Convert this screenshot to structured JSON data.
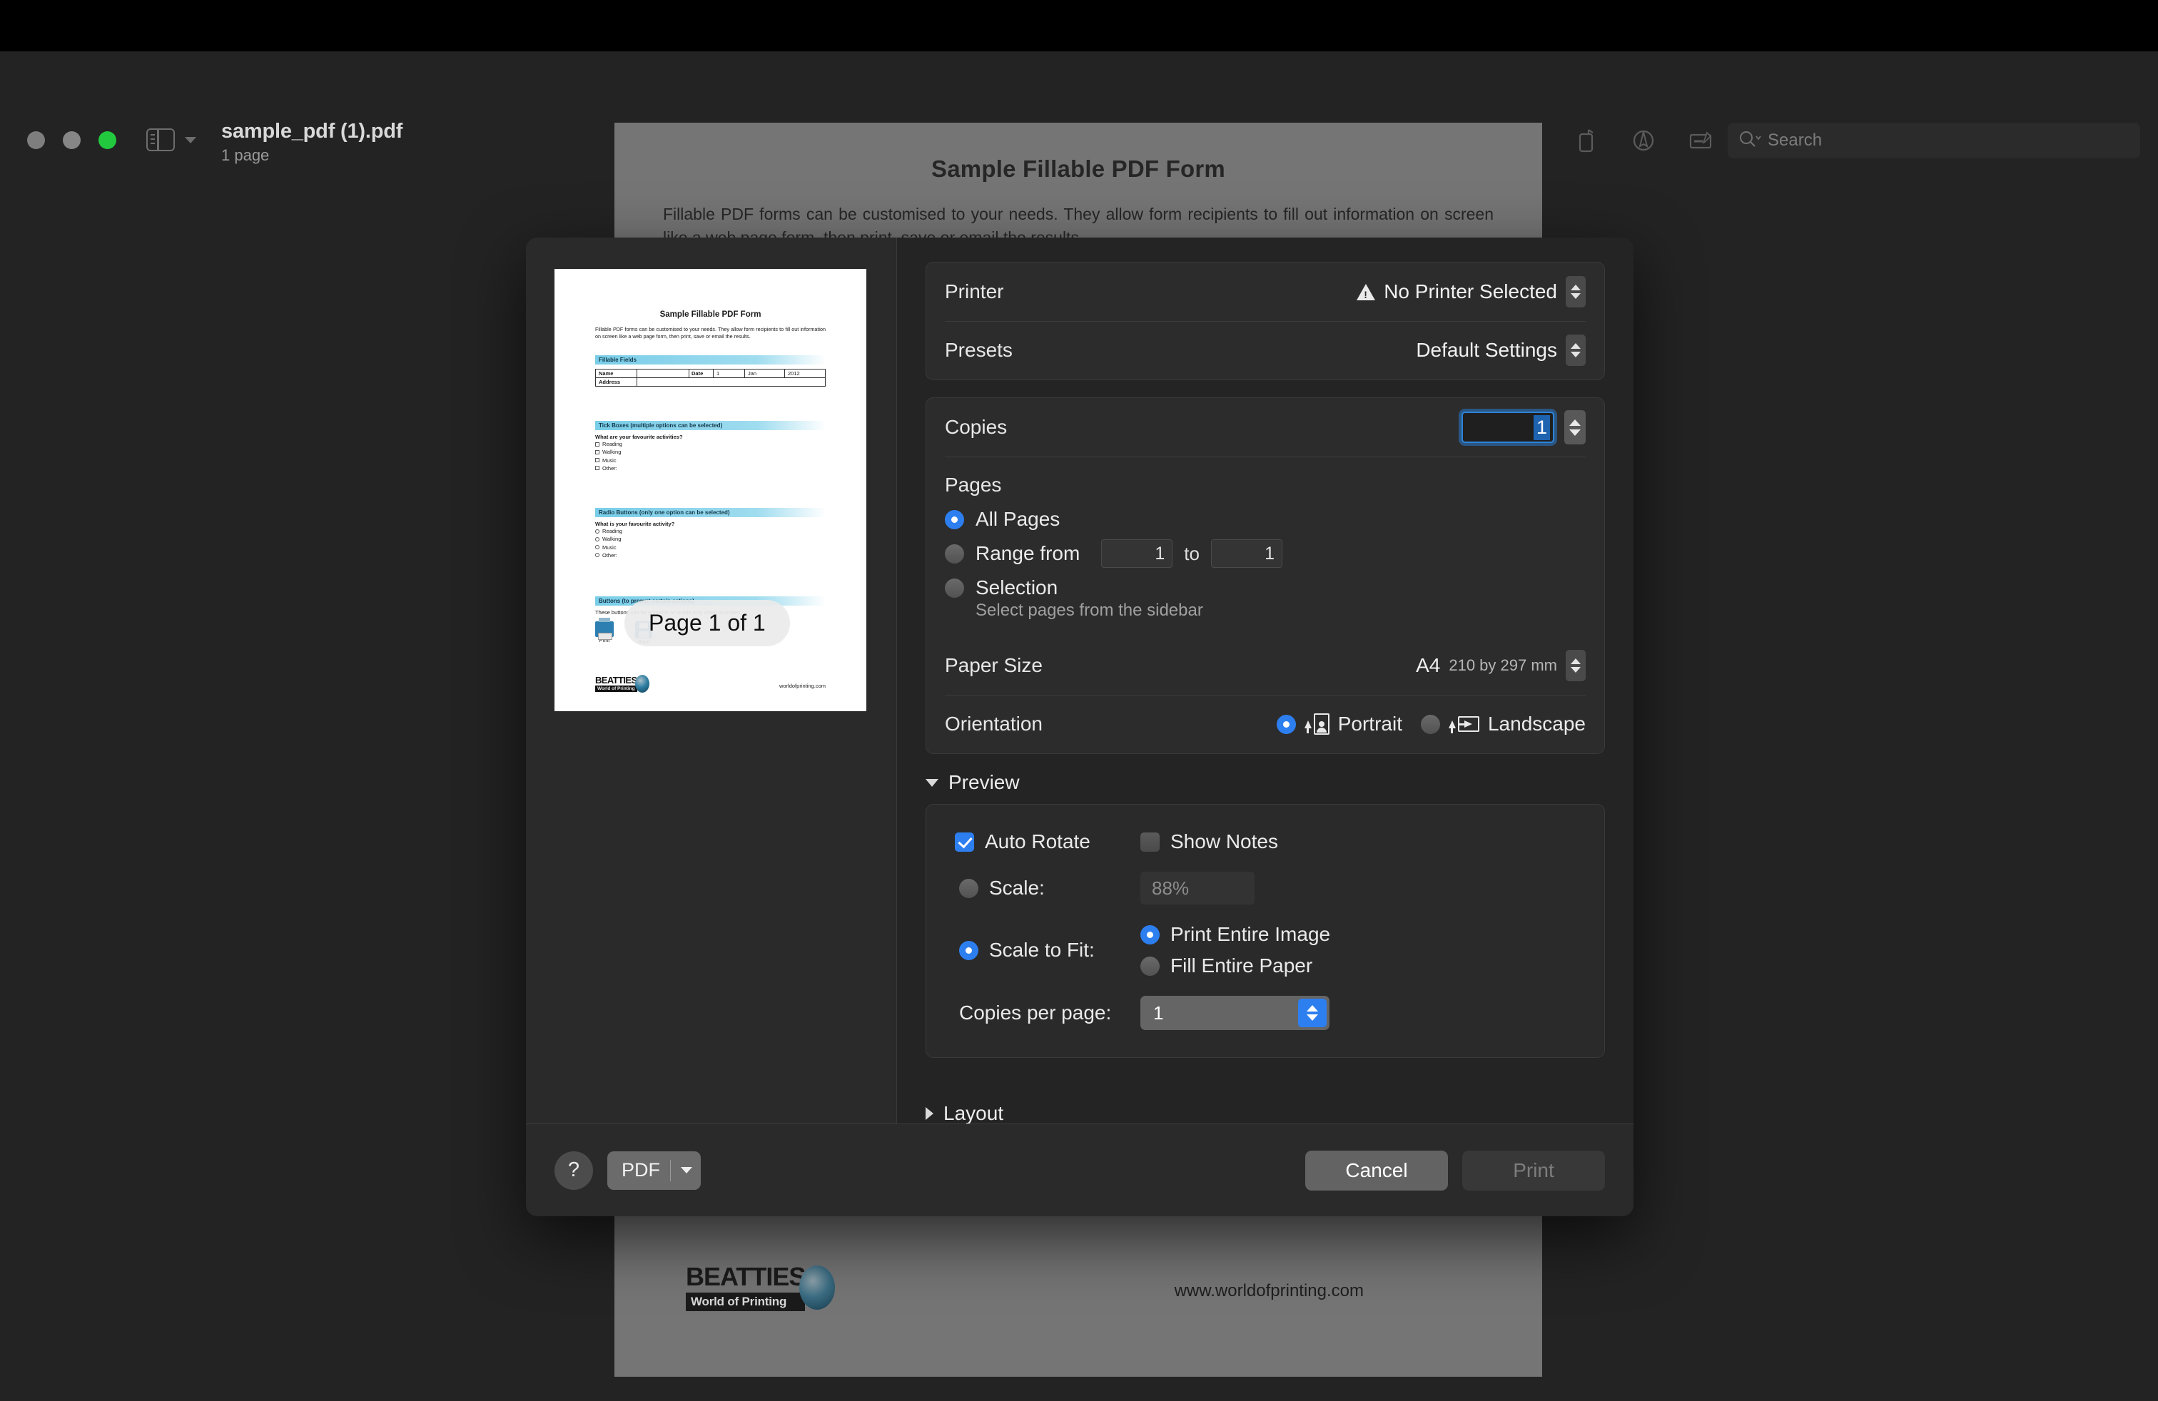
{
  "window": {
    "title": "sample_pdf (1).pdf",
    "subtitle": "1 page",
    "traffic_lights": [
      "close",
      "minimize",
      "maximize"
    ],
    "sidebar_toggle_icon": "sidebar-icon",
    "toolbar_icons": [
      "info-icon",
      "zoom-out-icon",
      "zoom-in-icon",
      "share-icon",
      "markup-pen-icon",
      "chevron-down-icon",
      "rotate-icon",
      "highlight-icon",
      "annotate-icon"
    ],
    "search": {
      "placeholder": "Search",
      "icon": "search-icon"
    }
  },
  "document": {
    "title": "Sample Fillable PDF Form",
    "intro": "Fillable PDF forms can be customised to your needs. They allow form recipients to fill out information on screen like a web page form, then print, save or email the results.",
    "logo_primary": "BEATTIES",
    "logo_secondary": "World of Printing",
    "url": "www.worldofprinting.com"
  },
  "thumbnail": {
    "title": "Sample Fillable PDF Form",
    "intro": "Fillable PDF forms can be customised to your needs. They allow form recipients to fill out information on screen like a web page form, then print, save or email the results.",
    "section_fields": "Fillable Fields",
    "field_name_label": "Name",
    "field_address_label": "Address",
    "field_date_label": "Date",
    "field_date_day": "1",
    "field_date_month": "Jan",
    "field_date_year": "2012",
    "section_tick": "Tick Boxes (multiple options can be selected)",
    "tick_question": "What are your favourite activities?",
    "tick_options": [
      "Reading",
      "Walking",
      "Music",
      "Other:"
    ],
    "section_radio": "Radio Buttons (only one option can be selected)",
    "radio_question": "What is your favourite activity?",
    "radio_options": [
      "Reading",
      "Walking",
      "Music",
      "Other:"
    ],
    "section_buttons": "Buttons (to prompt certain actions)",
    "buttons_desc": "These buttons can be printable or visible only when onscreen.",
    "button_print": "Print",
    "button_save": "Save",
    "logo_primary": "BEATTIES",
    "logo_secondary": "World of Printing",
    "url": "worldofprinting.com",
    "page_badge": "Page 1 of 1"
  },
  "print_dialog": {
    "printer": {
      "label": "Printer",
      "value": "No Printer Selected",
      "warning_icon": "warning-icon",
      "chevron_icon": "up-down-chevron-icon"
    },
    "presets": {
      "label": "Presets",
      "value": "Default Settings",
      "chevron_icon": "up-down-chevron-icon"
    },
    "copies": {
      "label": "Copies",
      "value": "1",
      "stepper_icon": "up-down-stepper-icon"
    },
    "pages": {
      "label": "Pages",
      "options": [
        {
          "label": "All Pages",
          "selected": true
        },
        {
          "label": "Range from",
          "selected": false
        },
        {
          "label": "Selection",
          "selected": false
        }
      ],
      "range_from": "1",
      "range_to_label": "to",
      "range_to": "1",
      "selection_hint": "Select pages from the sidebar"
    },
    "paper_size": {
      "label": "Paper Size",
      "value": "A4",
      "dimensions": "210 by 297 mm",
      "chevron_icon": "up-down-chevron-icon"
    },
    "orientation": {
      "label": "Orientation",
      "options": [
        {
          "label": "Portrait",
          "selected": true,
          "icon": "portrait-icon"
        },
        {
          "label": "Landscape",
          "selected": false,
          "icon": "landscape-icon"
        }
      ]
    },
    "preview_section": {
      "label": "Preview",
      "expanded": true,
      "auto_rotate": {
        "label": "Auto Rotate",
        "checked": true
      },
      "show_notes": {
        "label": "Show Notes",
        "checked": false
      },
      "scale": {
        "label": "Scale:",
        "selected": false,
        "value": "88%"
      },
      "scale_to_fit": {
        "label": "Scale to Fit:",
        "selected": true
      },
      "fit_options": [
        {
          "label": "Print Entire Image",
          "selected": true
        },
        {
          "label": "Fill Entire Paper",
          "selected": false
        }
      ],
      "copies_per_page": {
        "label": "Copies per page:",
        "value": "1"
      }
    },
    "layout_section": {
      "label": "Layout",
      "expanded": false
    },
    "footer": {
      "help_label": "?",
      "pdf_label": "PDF",
      "cancel_label": "Cancel",
      "print_label": "Print"
    }
  },
  "colors": {
    "accent": "#2d7ff0",
    "window_bg": "#232323",
    "sheet_bg": "#2a2a2a",
    "page_bg": "#757575"
  }
}
